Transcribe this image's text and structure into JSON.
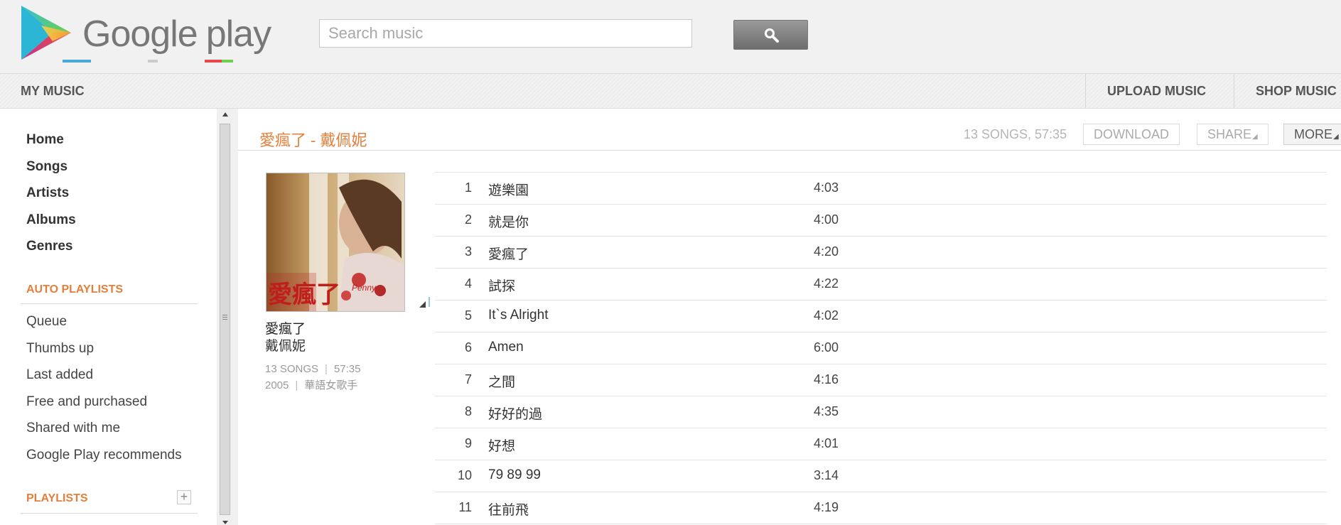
{
  "header": {
    "brand": "Google",
    "brand_suffix": "play",
    "search_placeholder": "Search music"
  },
  "navbar": {
    "my_music": "MY MUSIC",
    "upload": "UPLOAD MUSIC",
    "shop": "SHOP MUSIC"
  },
  "sidebar": {
    "nav": [
      "Home",
      "Songs",
      "Artists",
      "Albums",
      "Genres"
    ],
    "auto_playlists_heading": "AUTO PLAYLISTS",
    "auto_playlists": [
      "Queue",
      "Thumbs up",
      "Last added",
      "Free and purchased",
      "Shared with me",
      "Google Play recommends"
    ],
    "playlists_heading": "PLAYLISTS",
    "add_playlist_symbol": "+"
  },
  "album": {
    "header_title": "愛瘋了 - 戴佩妮",
    "summary": "13 SONGS, 57:35",
    "download_label": "DOWNLOAD",
    "share_label": "SHARE",
    "more_label": "MORE",
    "name": "愛瘋了",
    "artist": "戴佩妮",
    "song_count": "13 SONGS",
    "duration": "57:35",
    "year": "2005",
    "genre": "華語女歌手",
    "cover_text": "Penny"
  },
  "tracks": [
    {
      "num": "1",
      "title": "遊樂園",
      "duration": "4:03"
    },
    {
      "num": "2",
      "title": "就是你",
      "duration": "4:00"
    },
    {
      "num": "3",
      "title": "愛瘋了",
      "duration": "4:20"
    },
    {
      "num": "4",
      "title": "試探",
      "duration": "4:22"
    },
    {
      "num": "5",
      "title": "It`s Alright",
      "duration": "4:02"
    },
    {
      "num": "6",
      "title": "Amen",
      "duration": "6:00"
    },
    {
      "num": "7",
      "title": "之間",
      "duration": "4:16"
    },
    {
      "num": "8",
      "title": "好好的過",
      "duration": "4:35"
    },
    {
      "num": "9",
      "title": "好想",
      "duration": "4:01"
    },
    {
      "num": "10",
      "title": "79 89 99",
      "duration": "3:14"
    },
    {
      "num": "11",
      "title": "往前飛",
      "duration": "4:19"
    }
  ],
  "colors": {
    "accent": "#e47f3b",
    "page_bg": "#f1f1f1",
    "panel_bg": "#ffffff"
  },
  "icons": {
    "logo": "google-play-triangle-icon",
    "search": "magnifier-icon",
    "add": "plus-icon"
  }
}
